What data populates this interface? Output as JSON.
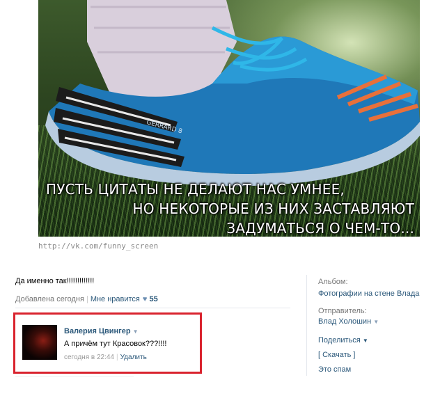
{
  "image": {
    "caption_line1": "ПУСТЬ ЦИТАТЫ НЕ ДЕЛАЮТ НАС УМНЕЕ,",
    "caption_line2": "НО НЕКОТОРЫЕ ИЗ НИХ ЗАСТАВЛЯЮТ ЗАДУМАТЬСЯ О ЧЕМ-ТО...",
    "shoe_brand_text": "GERRARD 8",
    "watermark_url": "http://vk.com/funny_screen"
  },
  "post": {
    "text": "Да именно так!!!!!!!!!!!!!",
    "added": "Добавлена сегодня",
    "like_label": "Мне нравится",
    "like_count": "55"
  },
  "comment": {
    "author": "Валерия Цвингер",
    "text": "А причём тут Красовок???!!!!",
    "time": "сегодня в 22:44",
    "delete_label": "Удалить"
  },
  "sidebar": {
    "album_label": "Альбом:",
    "album_value": "Фотографии на стене Влада",
    "sender_label": "Отправитель:",
    "sender_value": "Влад Холошин",
    "share_label": "Поделиться",
    "download_label": "[ Скачать ]",
    "spam_label": "Это спам"
  },
  "colors": {
    "link": "#2b587a",
    "highlight_border": "#d9232e"
  }
}
